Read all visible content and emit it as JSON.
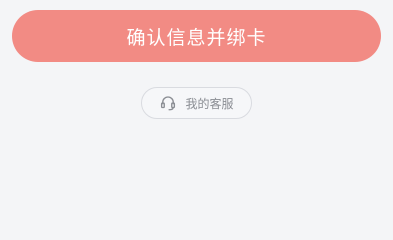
{
  "actions": {
    "confirm_label": "确认信息并绑卡",
    "customer_service_label": "我的客服"
  },
  "icons": {
    "customer_service": "headset-icon"
  },
  "colors": {
    "accent": "#f28b84",
    "background": "#f4f5f7",
    "secondary_text": "#8a8d93",
    "border": "#d9dbe0"
  }
}
